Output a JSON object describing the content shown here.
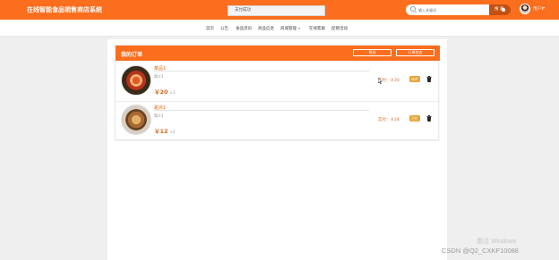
{
  "header": {
    "site_title": "在线智能食品销售商店系统",
    "toast": "支付成功",
    "search_placeholder": "输入关键词",
    "search_label": "搜 索",
    "user_name": "用户1",
    "brand_color": "#fa6e1e"
  },
  "nav": {
    "items": [
      {
        "label": "首页"
      },
      {
        "label": "公告"
      },
      {
        "label": "食品资讯"
      },
      {
        "label": "商品信息"
      },
      {
        "label": "商城管理",
        "has_dropdown": true
      },
      {
        "label": "在线客服"
      },
      {
        "label": "促销活动"
      }
    ]
  },
  "cart": {
    "title": "我的订单",
    "filter_button": "筛选",
    "sort_button": "订单状态",
    "items": [
      {
        "name": "菜品1",
        "desc": "简介1",
        "price": "￥20",
        "qty": "×1",
        "subtotal": "实付：￥20",
        "status": "待评"
      },
      {
        "name": "甜点1",
        "desc": "简介1",
        "price": "￥12",
        "qty": "×2",
        "subtotal": "实付：￥24",
        "status": "已付"
      }
    ]
  },
  "overlay": {
    "activate_windows": "激活 Windows",
    "credit": "CSDN @Q2_CXKF10088"
  }
}
